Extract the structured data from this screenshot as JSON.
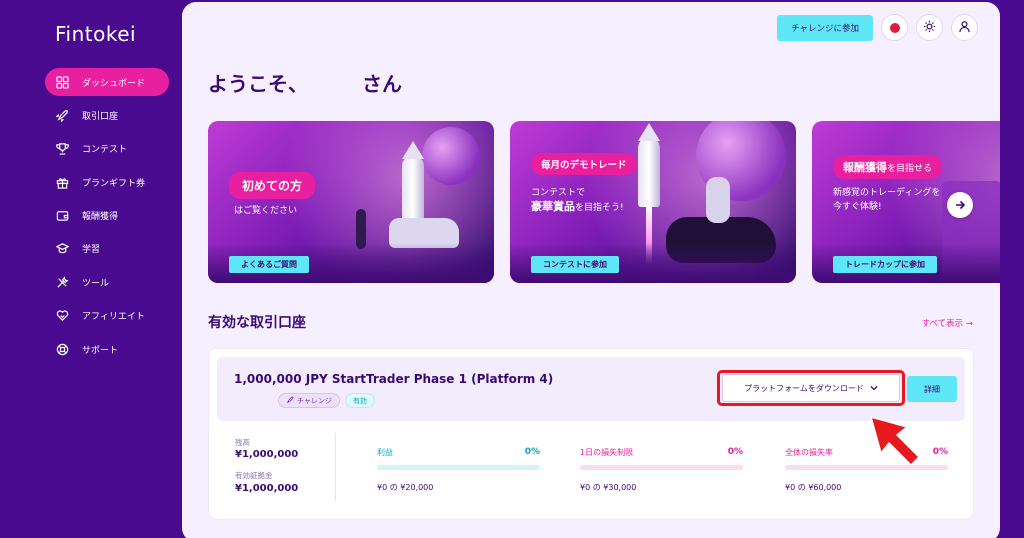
{
  "app": {
    "logo": "Fintokei"
  },
  "sidebar": {
    "items": [
      {
        "label": "ダッシュボード",
        "icon": "dashboard-icon",
        "active": true
      },
      {
        "label": "取引口座",
        "icon": "rocket-icon"
      },
      {
        "label": "コンテスト",
        "icon": "trophy-icon"
      },
      {
        "label": "プランギフト券",
        "icon": "gift-icon"
      },
      {
        "label": "報酬獲得",
        "icon": "wallet-icon"
      },
      {
        "label": "学習",
        "icon": "graduation-cap-icon"
      },
      {
        "label": "ツール",
        "icon": "tools-icon"
      },
      {
        "label": "アフィリエイト",
        "icon": "handshake-heart-icon"
      },
      {
        "label": "サポート",
        "icon": "lifebuoy-icon"
      }
    ]
  },
  "header": {
    "challenge_button": "チャレンジに参加",
    "flag_icon": "japan-flag-icon",
    "theme_icon": "sun-icon",
    "user_icon": "user-icon"
  },
  "welcome": {
    "greeting": "ようこそ、",
    "suffix": "さん"
  },
  "banners": [
    {
      "pill": "初めての方",
      "sub": "はご覧ください",
      "cta": "よくあるご質問"
    },
    {
      "pill": "毎月のデモトレード",
      "sub_line1": "コンテストで",
      "sub_line2_bold": "豪華賞品",
      "sub_line2_rest": "を目指そう!",
      "cta": "コンテストに参加"
    },
    {
      "pill_bold": "報酬獲得",
      "pill_rest": "を目指せる",
      "sub_line1": "新感覚のトレーディングを",
      "sub_line2": "今すぐ体験!",
      "cta": "トレードカップに参加",
      "next_icon": "arrow-right-icon"
    }
  ],
  "accounts_section": {
    "title": "有効な取引口座",
    "see_all": "すべて表示 →"
  },
  "account": {
    "name": "1,000,000 JPY StartTrader Phase 1 (Platform 4)",
    "tags": [
      "チャレンジ",
      "有効"
    ],
    "download_button": "プラットフォームをダウンロード",
    "detail_button": "詳細",
    "balance_label": "残高",
    "balance_value": "¥1,000,000",
    "margin_label": "有効証拠金",
    "margin_value": "¥1,000,000",
    "metrics": [
      {
        "label": "利益",
        "pct": "0%",
        "range": "¥0 の ¥20,000",
        "color": "#14a4bd",
        "bar": "#d3f3fa",
        "fill": 0
      },
      {
        "label": "1日の損失制限",
        "pct": "0%",
        "range": "¥0 の ¥30,000",
        "color": "#e8209f",
        "bar": "#fadcf0",
        "fill": 0
      },
      {
        "label": "全体の損失率",
        "pct": "0%",
        "range": "¥0 の ¥60,000",
        "color": "#e8209f",
        "bar": "#fadcf0",
        "fill": 0
      }
    ]
  },
  "colors": {
    "primary": "#4a0a8f",
    "accent": "#e8209f",
    "cyan": "#5ee8f7",
    "highlight": "#e8191e"
  }
}
